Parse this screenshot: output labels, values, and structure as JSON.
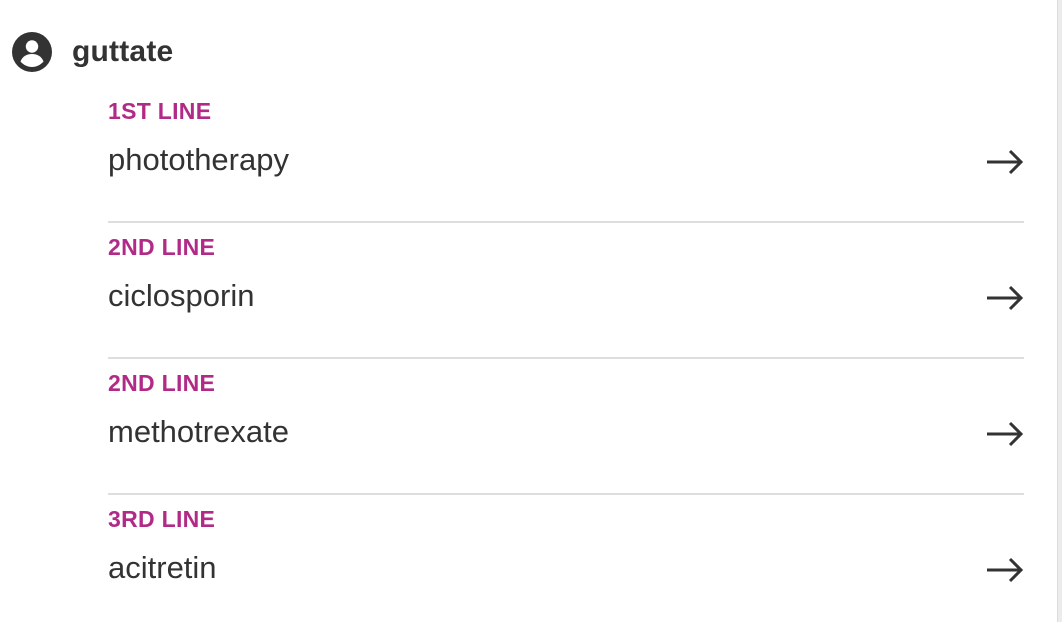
{
  "header": {
    "icon": "account-circle-icon",
    "title": "guttate"
  },
  "treatments": [
    {
      "line": "1ST LINE",
      "name": "phototherapy",
      "icon": "arrow-right-icon"
    },
    {
      "line": "2ND LINE",
      "name": "ciclosporin",
      "icon": "arrow-right-icon"
    },
    {
      "line": "2ND LINE",
      "name": "methotrexate",
      "icon": "arrow-right-icon"
    },
    {
      "line": "3RD LINE",
      "name": "acitretin",
      "icon": "arrow-right-icon"
    }
  ],
  "colors": {
    "line_label": "#b22a88",
    "text": "#333333",
    "divider": "#dedede"
  }
}
